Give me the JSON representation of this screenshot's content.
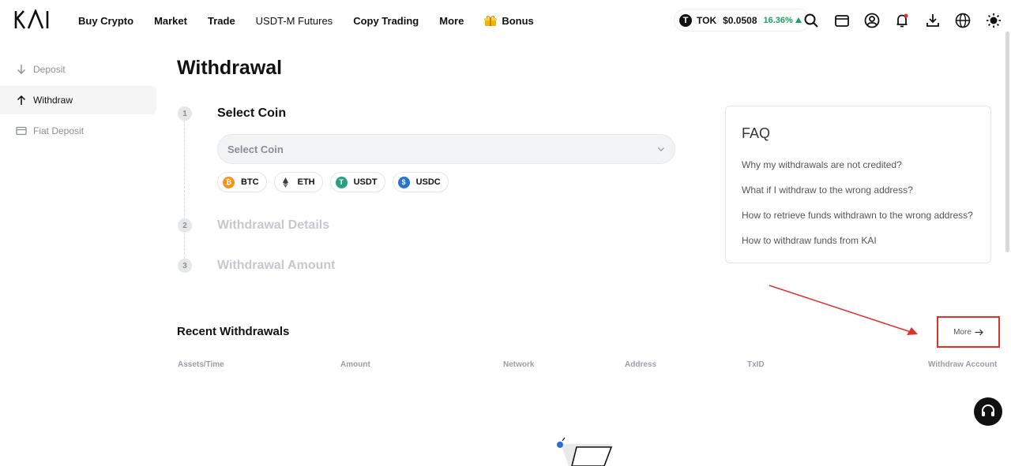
{
  "header": {
    "logo_text": "KAI",
    "nav": [
      {
        "label": "Buy Crypto"
      },
      {
        "label": "Market"
      },
      {
        "label": "Trade"
      },
      {
        "label": "USDT-M Futures"
      },
      {
        "label": "Copy Trading"
      },
      {
        "label": "More"
      },
      {
        "label": "Bonus"
      }
    ],
    "ticker": {
      "symbol": "TOK",
      "price": "$0.0508",
      "change": "16.36%",
      "change_color": "#19a35a"
    },
    "icons": [
      "search-icon",
      "wallet-icon",
      "user-icon",
      "bell-icon",
      "download-icon",
      "globe-icon",
      "theme-icon"
    ]
  },
  "sidebar": {
    "items": [
      {
        "label": "Deposit",
        "icon": "arrow-down-icon"
      },
      {
        "label": "Withdraw",
        "icon": "arrow-up-icon",
        "active": true
      },
      {
        "label": "Fiat Deposit",
        "icon": "card-icon"
      }
    ]
  },
  "main": {
    "title": "Withdrawal",
    "steps": [
      {
        "num": "1",
        "title": "Select Coin"
      },
      {
        "num": "2",
        "title": "Withdrawal Details"
      },
      {
        "num": "3",
        "title": "Withdrawal Amount"
      }
    ],
    "coin_select": {
      "placeholder": "Select Coin"
    },
    "quick_coins": [
      {
        "label": "BTC",
        "color": "#f7931a"
      },
      {
        "label": "ETH",
        "color": "#3c3c3d"
      },
      {
        "label": "USDT",
        "color": "#26a17b"
      },
      {
        "label": "USDC",
        "color": "#2775ca"
      }
    ]
  },
  "faq": {
    "title": "FAQ",
    "items": [
      "Why my withdrawals are not credited?",
      "What if I withdraw to the wrong address?",
      "How to retrieve funds withdrawn to the wrong address?",
      "How to withdraw funds from KAI"
    ]
  },
  "recent": {
    "title": "Recent Withdrawals",
    "more_label": "More",
    "columns": [
      "Assets/Time",
      "Amount",
      "Network",
      "Address",
      "TxID",
      "Withdraw Account"
    ]
  },
  "colors": {
    "highlight": "#e5302a"
  }
}
